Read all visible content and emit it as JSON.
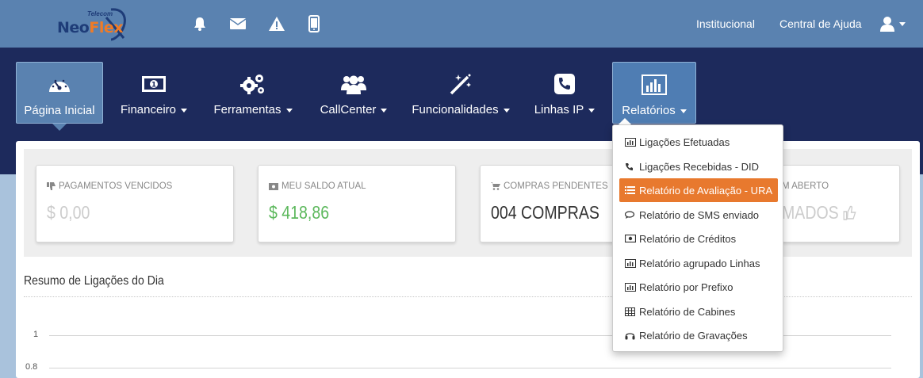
{
  "brand": {
    "name_a": "Neo",
    "name_b": "Flex",
    "tagline": "Telecom"
  },
  "top_links": {
    "institucional": "Institucional",
    "ajuda": "Central de Ajuda"
  },
  "top_icons": [
    "bell-icon",
    "envelope-icon",
    "warning-icon",
    "mobile-icon",
    "user-icon"
  ],
  "nav": {
    "items": [
      {
        "label": "Página Inicial",
        "icon": "dashboard-icon",
        "caret": false
      },
      {
        "label": "Financeiro",
        "icon": "money-icon",
        "caret": true
      },
      {
        "label": "Ferramentas",
        "icon": "gears-icon",
        "caret": true
      },
      {
        "label": "CallCenter",
        "icon": "group-icon",
        "caret": true
      },
      {
        "label": "Funcionalidades",
        "icon": "magic-wand-icon",
        "caret": true
      },
      {
        "label": "Linhas IP",
        "icon": "phone-icon",
        "caret": true
      },
      {
        "label": "Relatórios",
        "icon": "bar-chart-icon",
        "caret": true
      }
    ]
  },
  "stats": [
    {
      "title": "PAGAMENTOS VENCIDOS",
      "value": "$ 0,00",
      "icon": "thumbs-down-icon",
      "color": "#cccccc"
    },
    {
      "title": "MEU SALDO ATUAL",
      "value": "$ 418,86",
      "icon": "money-icon",
      "color": "#5cb85c"
    },
    {
      "title": "COMPRAS PENDENTES",
      "value": "004 COMPRAS",
      "icon": "cart-icon",
      "color": "#333333"
    },
    {
      "title": "M ABERTO",
      "value": "MADOS",
      "icon": "thumbs-up-icon",
      "color": "#cccccc"
    }
  ],
  "section": {
    "title": "Resumo de Ligações do Dia"
  },
  "chart_data": {
    "type": "line",
    "title": "",
    "yticks": [
      "1",
      "0.8"
    ],
    "series": []
  },
  "dropdown": {
    "items": [
      {
        "label": "Ligações Efetuadas",
        "icon": "bar-chart-icon"
      },
      {
        "label": "Ligações Recebidas - DID",
        "icon": "phone-icon"
      },
      {
        "label": "Relatório de Avaliação - URA",
        "icon": "list-icon",
        "highlight": true
      },
      {
        "label": "Relatório de SMS enviado",
        "icon": "comments-icon"
      },
      {
        "label": "Relatório de Créditos",
        "icon": "money-icon"
      },
      {
        "label": "Relatório agrupado Linhas",
        "icon": "bar-chart-icon"
      },
      {
        "label": "Relatório por Prefixo",
        "icon": "bar-chart-icon"
      },
      {
        "label": "Relatório de Cabines",
        "icon": "table-icon"
      },
      {
        "label": "Relatório de Gravações",
        "icon": "headphones-icon"
      }
    ]
  },
  "colors": {
    "topbar": "#5a82b0",
    "navbar": "#1d2a5c",
    "accent": "#e8792e",
    "positive": "#5cb85c"
  }
}
